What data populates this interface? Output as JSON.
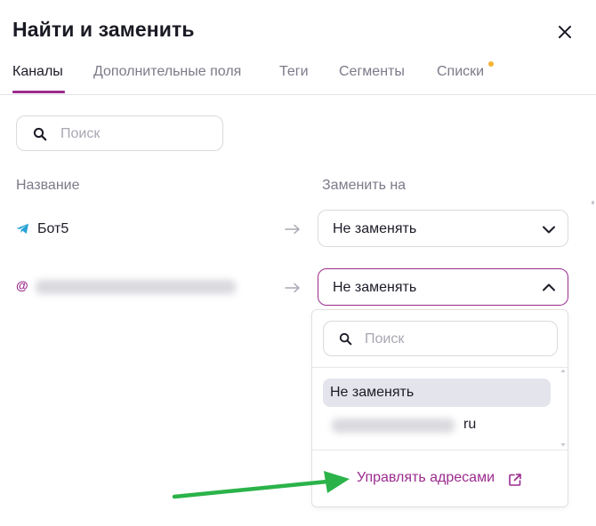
{
  "dialog": {
    "title": "Найти и заменить"
  },
  "tabs": [
    {
      "label": "Каналы",
      "active": true
    },
    {
      "label": "Дополнительные поля",
      "active": false
    },
    {
      "label": "Теги",
      "active": false
    },
    {
      "label": "Сегменты",
      "active": false
    },
    {
      "label": "Списки",
      "active": false,
      "has_dot": true
    }
  ],
  "search": {
    "placeholder": "Поиск",
    "value": ""
  },
  "columns": {
    "name": "Название",
    "replace_with": "Заменить на"
  },
  "rows": [
    {
      "icon": "telegram-icon",
      "name": "Бот5",
      "select_value": "Не заменять",
      "open": false
    },
    {
      "icon": "at-sign-icon",
      "name": "",
      "select_value": "Не заменять",
      "open": true
    }
  ],
  "dropdown": {
    "search_placeholder": "Поиск",
    "options": [
      {
        "label": "Не заменять",
        "selected": true
      },
      {
        "label": "ru",
        "selected": false
      }
    ],
    "manage_link": "Управлять адресами"
  },
  "colors": {
    "accent": "#9b2b8e",
    "annotation_arrow": "#2bb34a",
    "tab_dot": "#f5b234"
  }
}
